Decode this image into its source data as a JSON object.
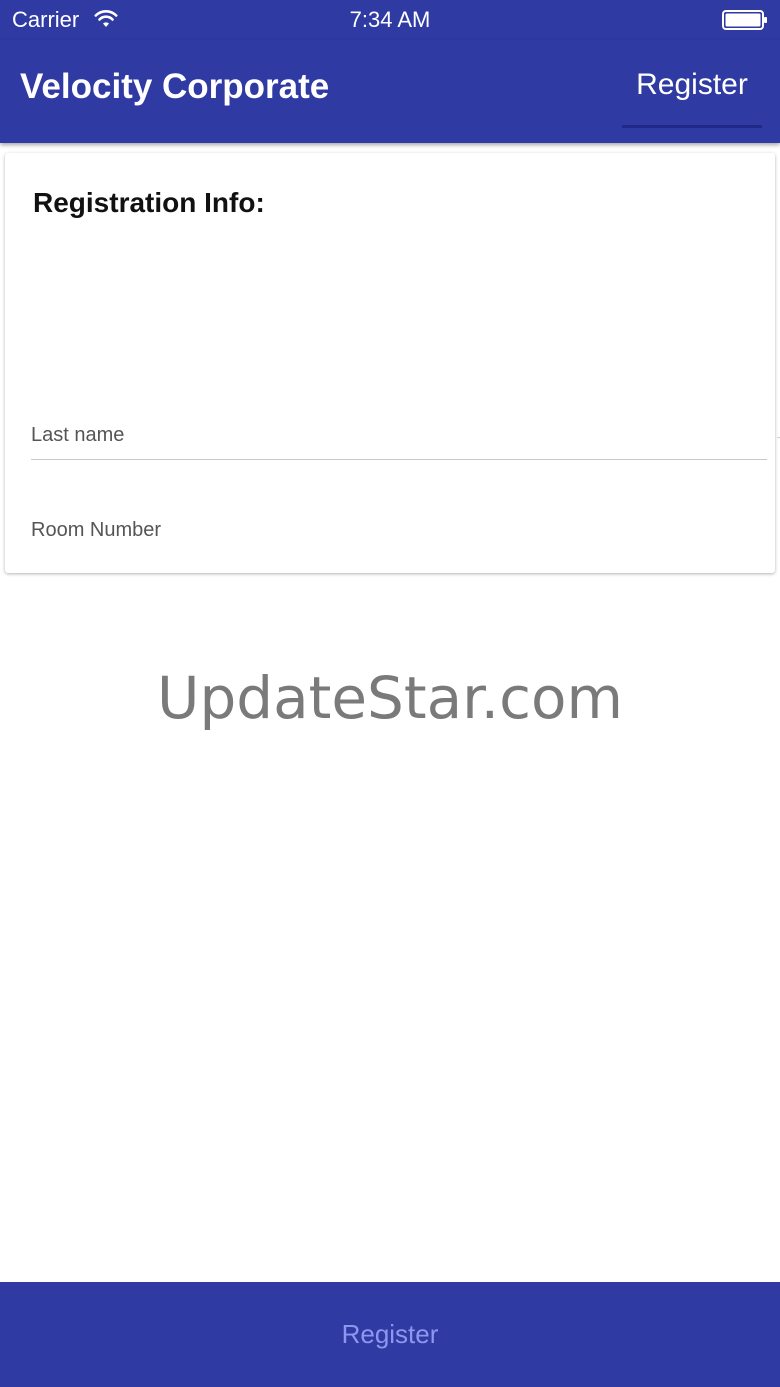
{
  "status_bar": {
    "carrier": "Carrier",
    "time": "7:34 AM",
    "wifi_icon": "wifi-icon",
    "battery_icon": "battery-icon"
  },
  "app_bar": {
    "title": "Velocity Corporate",
    "register_label": "Register",
    "color": "#2f3aa2"
  },
  "card": {
    "heading": "Registration Info:",
    "fields": [
      {
        "placeholder": "Last name",
        "value": ""
      },
      {
        "placeholder": "Room Number",
        "value": ""
      }
    ]
  },
  "watermark": "UpdateStar.com",
  "bottom_button": {
    "label": "Register",
    "text_color": "#8c97f0"
  }
}
